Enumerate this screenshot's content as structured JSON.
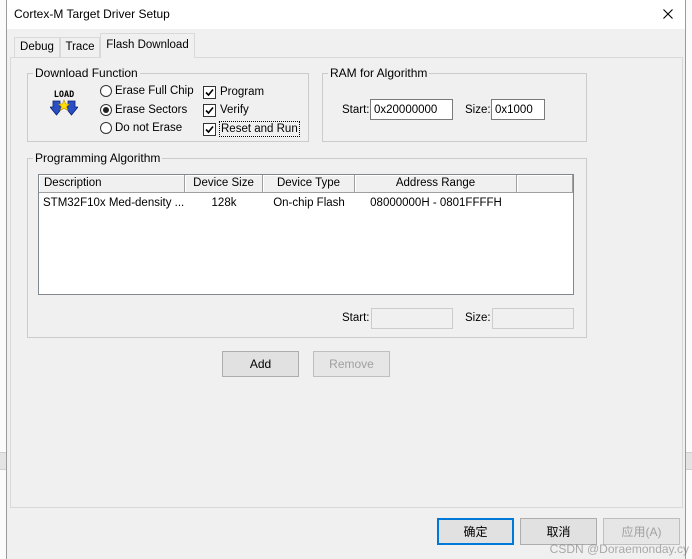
{
  "window": {
    "title": "Cortex-M Target Driver Setup",
    "close_icon": "close-icon"
  },
  "tabs": [
    {
      "label": "Debug",
      "active": false
    },
    {
      "label": "Trace",
      "active": false
    },
    {
      "label": "Flash Download",
      "active": true
    }
  ],
  "download_function": {
    "title": "Download Function",
    "icon": {
      "name": "load-icon",
      "text": "LOAD"
    },
    "radios": [
      {
        "label": "Erase Full Chip",
        "checked": false
      },
      {
        "label": "Erase Sectors",
        "checked": true
      },
      {
        "label": "Do not Erase",
        "checked": false
      }
    ],
    "checkboxes": [
      {
        "label": "Program",
        "checked": true
      },
      {
        "label": "Verify",
        "checked": true
      },
      {
        "label": "Reset and Run",
        "checked": true
      }
    ]
  },
  "ram_for_algorithm": {
    "title": "RAM for Algorithm",
    "start_label": "Start:",
    "start_value": "0x20000000",
    "size_label": "Size:",
    "size_value": "0x1000"
  },
  "programming_algorithm": {
    "title": "Programming Algorithm",
    "columns": [
      "Description",
      "Device Size",
      "Device Type",
      "Address Range"
    ],
    "rows": [
      [
        "STM32F10x Med-density ...",
        "128k",
        "On-chip Flash",
        "08000000H - 0801FFFFH"
      ]
    ],
    "start_label": "Start:",
    "start_value": "",
    "size_label": "Size:",
    "size_value": ""
  },
  "buttons": {
    "add": "Add",
    "remove": "Remove"
  },
  "footer": {
    "ok": "确定",
    "cancel": "取消",
    "apply": "应用(A)"
  },
  "colors": {
    "dialog_bg": "#f0f0f0",
    "default_button_accent": "#0078d7",
    "disabled_text": "#a0a0a0"
  },
  "watermark": "CSDN @Doraemonday.cy"
}
